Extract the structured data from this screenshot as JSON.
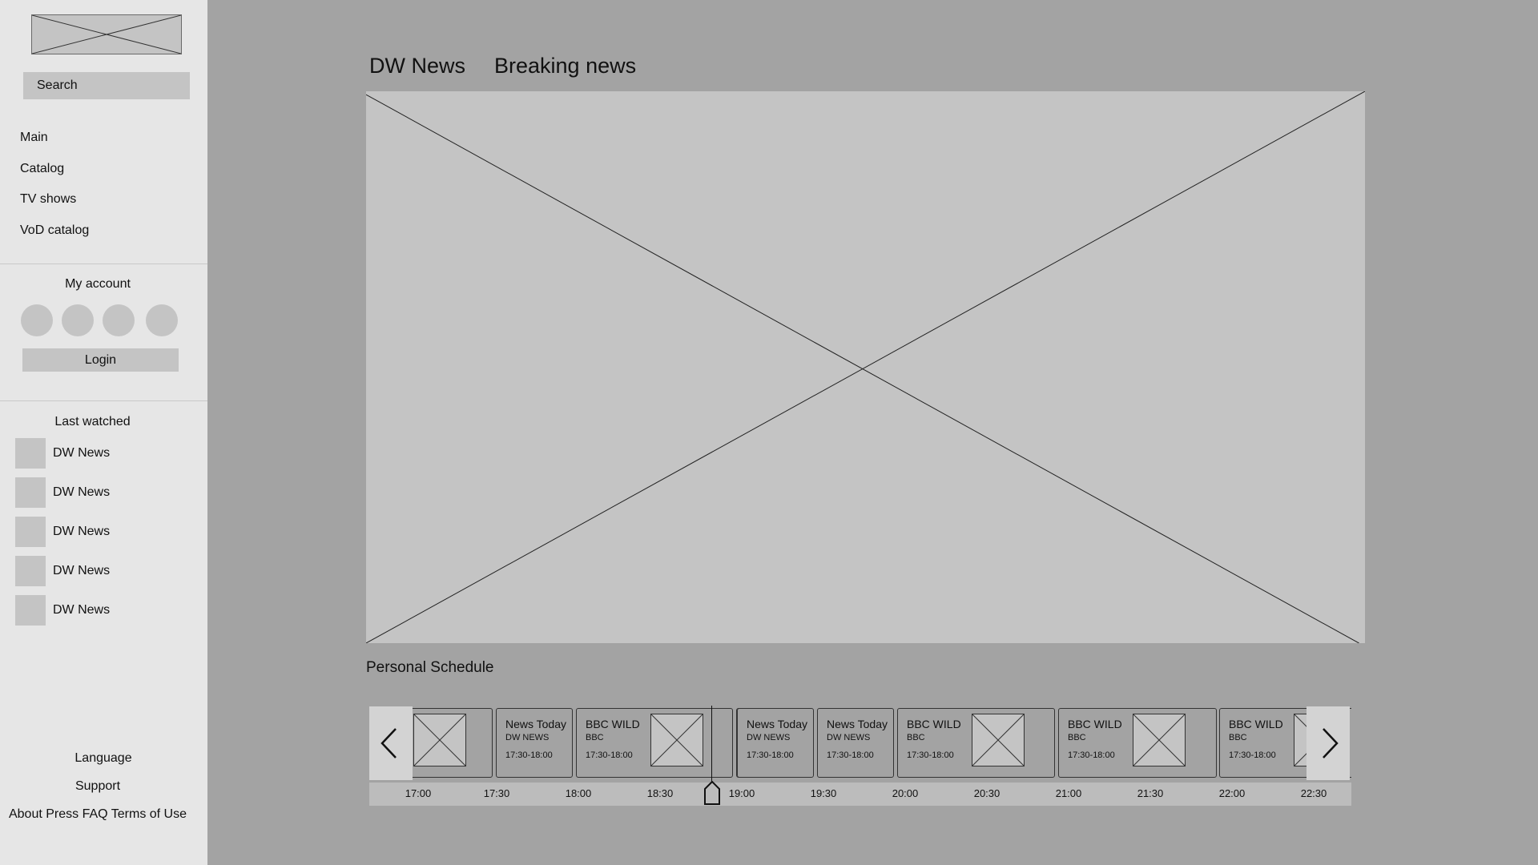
{
  "sidebar": {
    "search_placeholder": "Search",
    "nav": [
      {
        "label": "Main"
      },
      {
        "label": "Catalog"
      },
      {
        "label": "TV shows"
      },
      {
        "label": "VoD catalog"
      }
    ],
    "account_title": "My account",
    "login_label": "Login",
    "last_watched_title": "Last watched",
    "last_watched": [
      {
        "label": "DW News"
      },
      {
        "label": "DW News"
      },
      {
        "label": "DW News"
      },
      {
        "label": "DW News"
      },
      {
        "label": "DW News"
      }
    ],
    "footer": {
      "language": "Language",
      "support": "Support",
      "about": "About",
      "press": "Press",
      "faq": "FAQ",
      "terms": "Terms of Use"
    }
  },
  "main": {
    "channel_title": "DW News",
    "program_title": "Breaking news",
    "schedule_title": "Personal Schedule"
  },
  "schedule": {
    "programs": [
      {
        "title": "",
        "channel": "",
        "time": "",
        "thumb": true
      },
      {
        "title": "News Today",
        "channel": "DW NEWS",
        "time": "17:30-18:00",
        "thumb": false
      },
      {
        "title": "BBC WILD",
        "channel": "BBC",
        "time": "17:30-18:00",
        "thumb": true
      },
      {
        "title": "",
        "channel": "",
        "time": "",
        "thumb": false
      },
      {
        "title": "News Today",
        "channel": "DW NEWS",
        "time": "17:30-18:00",
        "thumb": false
      },
      {
        "title": "News Today",
        "channel": "DW NEWS",
        "time": "17:30-18:00",
        "thumb": false
      },
      {
        "title": "BBC WILD",
        "channel": "BBC",
        "time": "17:30-18:00",
        "thumb": true
      },
      {
        "title": "BBC WILD",
        "channel": "BBC",
        "time": "17:30-18:00",
        "thumb": true
      },
      {
        "title": "BBC WILD",
        "channel": "BBC",
        "time": "17:30-18:00",
        "thumb": true
      }
    ],
    "times": [
      "17:00",
      "17:30",
      "18:00",
      "18:30",
      "19:00",
      "19:30",
      "20:00",
      "20:30",
      "21:00",
      "21:30",
      "22:00",
      "22:30"
    ]
  }
}
